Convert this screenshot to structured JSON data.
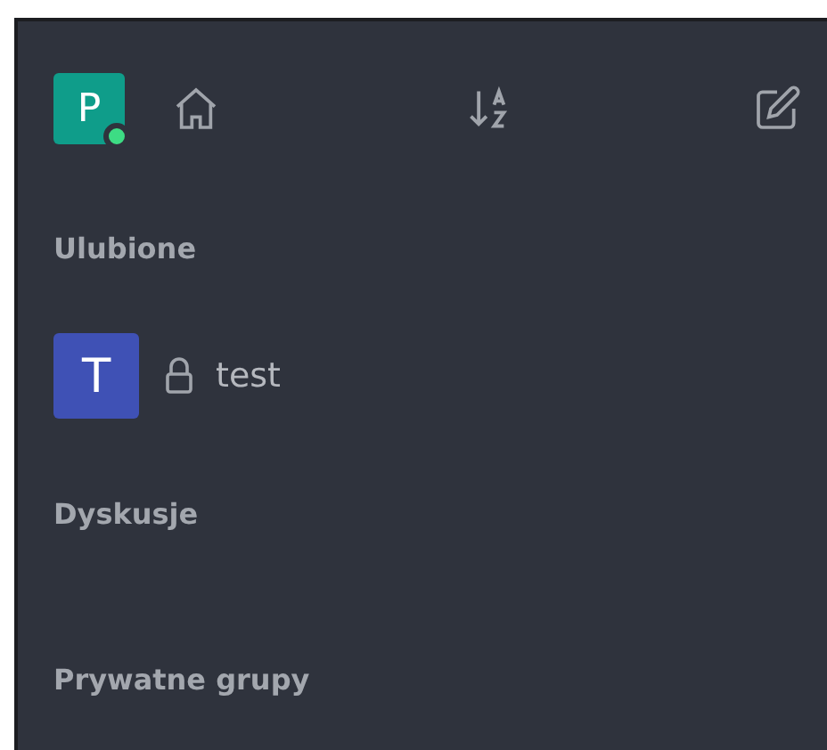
{
  "header": {
    "avatar": {
      "letter": "P",
      "online": true
    }
  },
  "sections": [
    {
      "title": "Ulubione",
      "items": [
        {
          "letter": "T",
          "name": "test",
          "locked": true
        }
      ]
    },
    {
      "title": "Dyskusje"
    },
    {
      "title": "Prywatne grupy"
    }
  ]
}
